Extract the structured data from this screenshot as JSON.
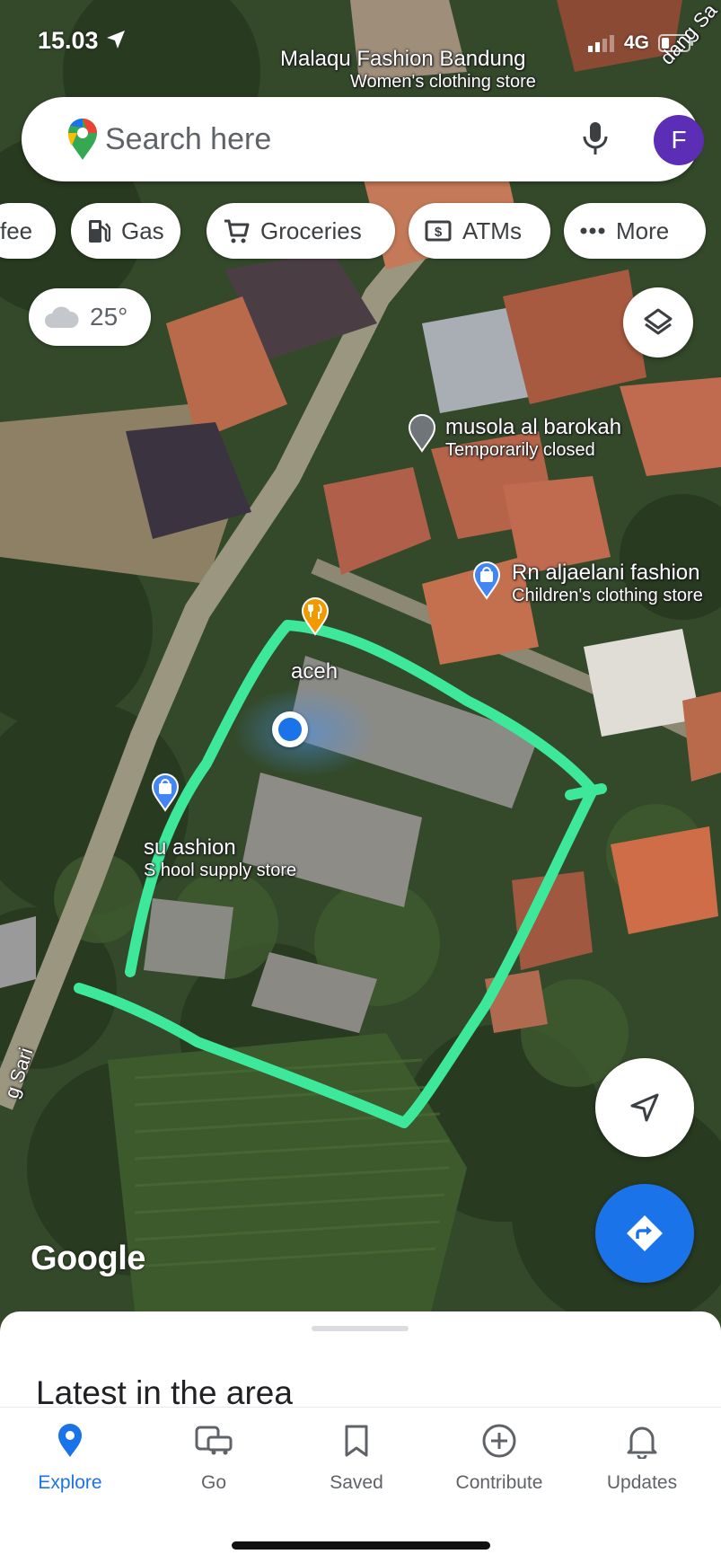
{
  "status_bar": {
    "time": "15.03",
    "network": "4G"
  },
  "search": {
    "placeholder": "Search here",
    "avatar_letter": "F"
  },
  "chips": [
    {
      "label": "fee",
      "icon": "coffee-icon"
    },
    {
      "label": "Gas",
      "icon": "gas-station-icon"
    },
    {
      "label": "Groceries",
      "icon": "cart-icon"
    },
    {
      "label": "ATMs",
      "icon": "atm-icon"
    },
    {
      "label": "More",
      "icon": "more-dots-icon"
    }
  ],
  "weather": {
    "temp": "25°",
    "icon": "cloud-icon"
  },
  "map": {
    "places": [
      {
        "name": "Malaqu Fashion Bandung",
        "category": "Women's clothing store"
      },
      {
        "name": "musola al barokah",
        "category": "Temporarily closed"
      },
      {
        "name": "Rn aljaelani fashion",
        "category": "Children's clothing store"
      },
      {
        "name": "aceh",
        "category": ""
      },
      {
        "name": "su ashion",
        "category": "S hool supply store"
      }
    ],
    "road_labels": [
      "dang Sa",
      "g Sari"
    ],
    "attribution": "Google",
    "annotation_color": "#3ee89a",
    "my_location_color": "#1a73e8"
  },
  "bottom_sheet": {
    "title": "Latest in the area"
  },
  "nav": [
    {
      "label": "Explore",
      "icon": "explore-pin-icon",
      "active": true
    },
    {
      "label": "Go",
      "icon": "commute-icon",
      "active": false
    },
    {
      "label": "Saved",
      "icon": "bookmark-icon",
      "active": false
    },
    {
      "label": "Contribute",
      "icon": "add-circle-icon",
      "active": false
    },
    {
      "label": "Updates",
      "icon": "bell-icon",
      "active": false
    }
  ],
  "colors": {
    "accent": "#1a73e8",
    "avatar": "#5c2db5"
  }
}
